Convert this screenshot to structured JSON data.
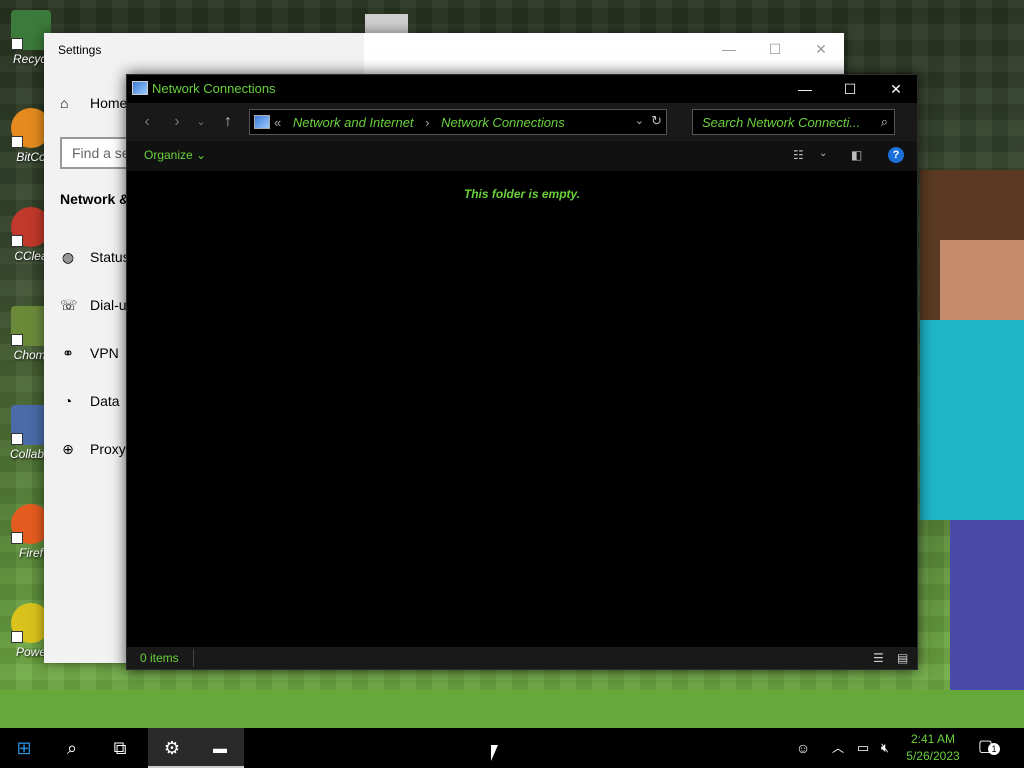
{
  "desktop": {
    "icons": [
      {
        "label": "Recycl",
        "color": "#3b7a3b"
      },
      {
        "label": "BitCo",
        "color": "#e48a1f"
      },
      {
        "label": "CClea",
        "color": "#c0392b"
      },
      {
        "label": "Chomi",
        "color": "#6a8a3a"
      },
      {
        "label": "CollabS",
        "color": "#4a6aa8"
      },
      {
        "label": "Firef",
        "color": "#e55b1f"
      },
      {
        "label": "Powe",
        "color": "#d9c21c"
      }
    ]
  },
  "settings": {
    "title": "Settings",
    "minimize": "—",
    "maximize": "☐",
    "close": "✕",
    "home_label": "Home",
    "search_placeholder": "Find a se",
    "section_title": "Network &",
    "nav": [
      {
        "label": "Status",
        "icon": "globe-icon"
      },
      {
        "label": "Dial-u",
        "icon": "dialup-icon"
      },
      {
        "label": "VPN",
        "icon": "vpn-icon"
      },
      {
        "label": "Data",
        "icon": "data-usage-icon"
      },
      {
        "label": "Proxy",
        "icon": "proxy-globe-icon"
      }
    ]
  },
  "explorer": {
    "title": "Network Connections",
    "minimize": "—",
    "maximize": "☐",
    "close": "✕",
    "address": {
      "overflow": "«",
      "crumbs": [
        "Network and Internet",
        "Network Connections"
      ],
      "separator": "›"
    },
    "search_placeholder": "Search Network Connecti...",
    "organize_label": "Organize",
    "empty_message": "This folder is empty.",
    "status_items": "0 items"
  },
  "taskbar": {
    "clock_time": "2:41 AM",
    "clock_date": "5/26/2023",
    "notification_count": "1"
  },
  "colors": {
    "accent_text": "#69d13c",
    "explorer_bg": "#000000",
    "taskbar_bg": "#000000"
  }
}
